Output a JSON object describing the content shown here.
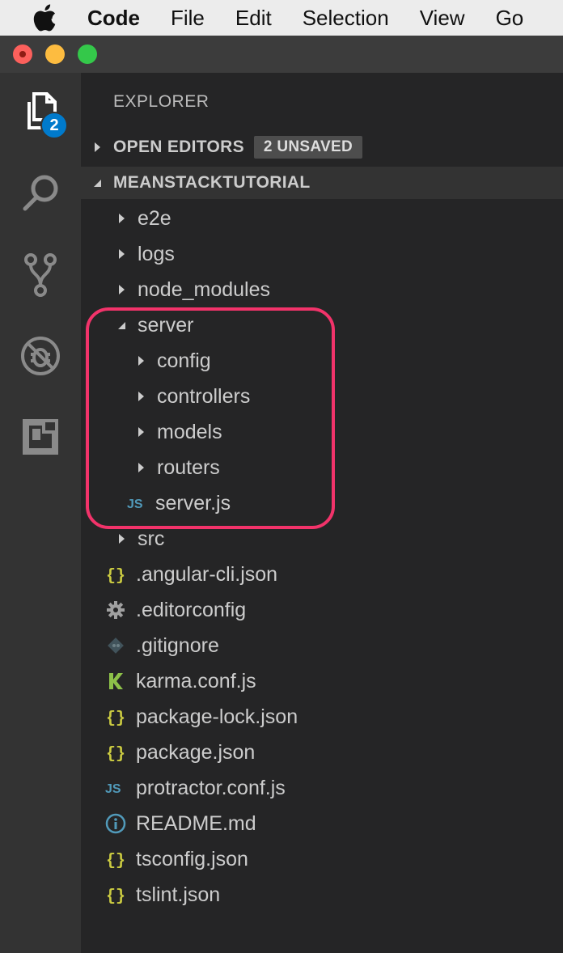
{
  "menubar": {
    "items": [
      "Code",
      "File",
      "Edit",
      "Selection",
      "View",
      "Go"
    ]
  },
  "activity": {
    "badge": "2"
  },
  "explorer": {
    "title": "EXPLORER",
    "open_editors": {
      "label": "OPEN EDITORS",
      "badge": "2 UNSAVED"
    },
    "project": {
      "label": "MEANSTACKTUTORIAL"
    },
    "tree": [
      {
        "label": "e2e",
        "type": "folder",
        "level": 1,
        "expanded": false
      },
      {
        "label": "logs",
        "type": "folder",
        "level": 1,
        "expanded": false
      },
      {
        "label": "node_modules",
        "type": "folder",
        "level": 1,
        "expanded": false
      },
      {
        "label": "server",
        "type": "folder",
        "level": 1,
        "expanded": true
      },
      {
        "label": "config",
        "type": "folder",
        "level": 2,
        "expanded": false
      },
      {
        "label": "controllers",
        "type": "folder",
        "level": 2,
        "expanded": false
      },
      {
        "label": "models",
        "type": "folder",
        "level": 2,
        "expanded": false
      },
      {
        "label": "routers",
        "type": "folder",
        "level": 2,
        "expanded": false
      },
      {
        "label": "server.js",
        "type": "js",
        "level": 2
      },
      {
        "label": "src",
        "type": "folder",
        "level": 1,
        "expanded": false
      },
      {
        "label": ".angular-cli.json",
        "type": "json",
        "level": 1
      },
      {
        "label": ".editorconfig",
        "type": "gear",
        "level": 1
      },
      {
        "label": ".gitignore",
        "type": "git",
        "level": 1
      },
      {
        "label": "karma.conf.js",
        "type": "karma",
        "level": 1
      },
      {
        "label": "package-lock.json",
        "type": "json",
        "level": 1
      },
      {
        "label": "package.json",
        "type": "json",
        "level": 1
      },
      {
        "label": "protractor.conf.js",
        "type": "js",
        "level": 1
      },
      {
        "label": "README.md",
        "type": "info",
        "level": 1
      },
      {
        "label": "tsconfig.json",
        "type": "json",
        "level": 1
      },
      {
        "label": "tslint.json",
        "type": "json",
        "level": 1
      }
    ]
  },
  "colors": {
    "json_icon": "#cbcb41",
    "js_icon": "#519aba",
    "karma_icon": "#8dc149",
    "gear_icon": "#a0a0a0",
    "highlight": "#f2336a",
    "badge_blue": "#007acc"
  }
}
